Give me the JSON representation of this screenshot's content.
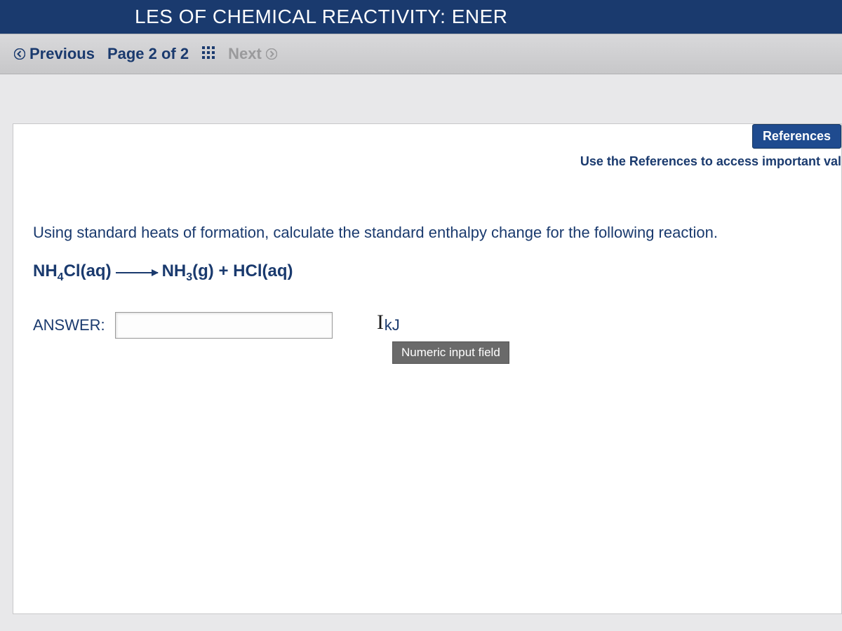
{
  "header": {
    "title_visible": "LES OF CHEMICAL REACTIVITY: ENER"
  },
  "nav": {
    "previous_label": "Previous",
    "page_indicator": "Page 2 of 2",
    "next_label": "Next"
  },
  "references": {
    "button_label": "References",
    "hint_text": "Use the References to access important val"
  },
  "question": {
    "prompt": "Using standard heats of formation, calculate the standard enthalpy change for the following reaction.",
    "reactant": "NH₄Cl(aq)",
    "product": "NH₃(g) + HCl(aq)"
  },
  "answer": {
    "label": "ANSWER:",
    "value": "",
    "unit": "kJ",
    "tooltip": "Numeric input field"
  }
}
